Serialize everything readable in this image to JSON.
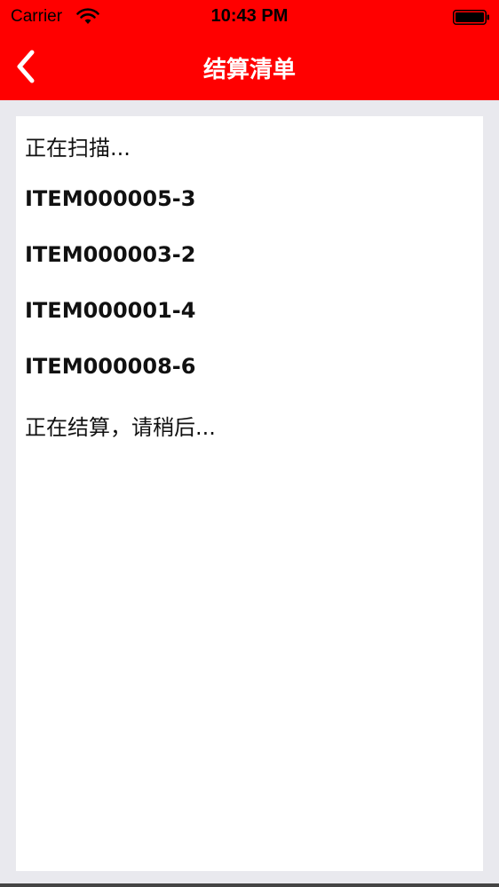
{
  "status_bar": {
    "carrier": "Carrier",
    "time": "10:43 PM",
    "wifi_icon": "wifi-icon",
    "battery_icon": "battery-icon"
  },
  "nav": {
    "title": "结算清单",
    "back_icon": "chevron-left-icon"
  },
  "log": {
    "lines": [
      "正在扫描...",
      "ITEM000005-3",
      "ITEM000003-2",
      "ITEM000001-4",
      "ITEM000008-6",
      "正在结算，请稍后..."
    ]
  },
  "colors": {
    "accent": "#ff0000",
    "background": "#e9e9ee",
    "card": "#ffffff"
  }
}
